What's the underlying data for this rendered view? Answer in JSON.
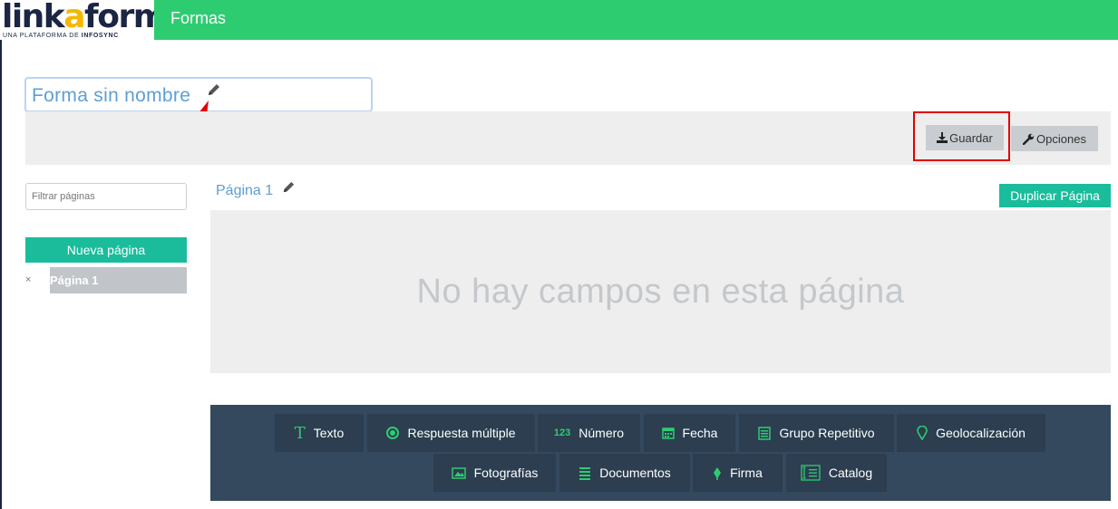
{
  "header": {
    "logo_text_1": "link",
    "logo_text_accent": "a",
    "logo_text_2": "form",
    "logo_tagline_1": "UNA PLATAFORMA DE ",
    "logo_tagline_2": "INFOSYNC",
    "section_title": "Formas"
  },
  "form": {
    "title": "Forma sin nombre"
  },
  "toolbar": {
    "save_label": "Guardar",
    "options_label": "Opciones"
  },
  "sidebar": {
    "filter_placeholder": "Filtrar páginas",
    "new_page_label": "Nueva página",
    "remove_symbol": "×",
    "pages": [
      {
        "label": "Página 1"
      }
    ]
  },
  "page": {
    "title": "Página 1",
    "duplicate_label": "Duplicar Página",
    "empty_message": "No hay campos en esta página"
  },
  "palette": {
    "fields": [
      {
        "label": "Texto",
        "icon": "text-T-icon"
      },
      {
        "label": "Respuesta múltiple",
        "icon": "radio-icon"
      },
      {
        "label": "Número",
        "icon": "123-icon",
        "icon_text": "123"
      },
      {
        "label": "Fecha",
        "icon": "calendar-icon"
      },
      {
        "label": "Grupo Repetitivo",
        "icon": "list-icon"
      },
      {
        "label": "Geolocalización",
        "icon": "map-pin-icon"
      },
      {
        "label": "Fotografías",
        "icon": "image-icon"
      },
      {
        "label": "Documentos",
        "icon": "document-icon"
      },
      {
        "label": "Firma",
        "icon": "pen-icon"
      },
      {
        "label": "Catalog",
        "icon": "catalog-icon"
      }
    ]
  },
  "colors": {
    "brand_green": "#2ecc71",
    "accent_teal": "#1abc9c",
    "palette_bg": "#34495e",
    "highlight_red": "#e10000"
  }
}
